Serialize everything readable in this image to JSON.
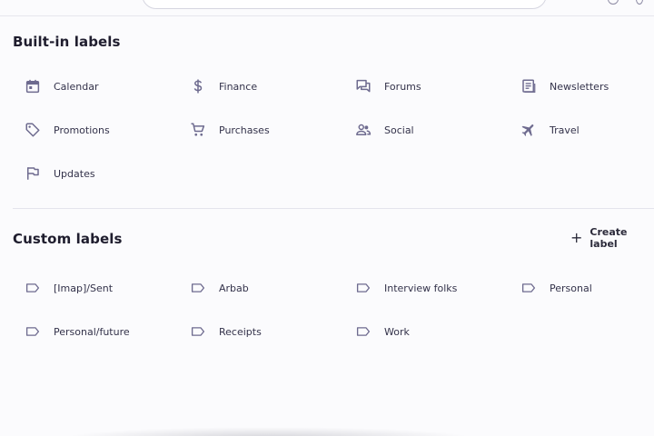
{
  "builtin": {
    "title": "Built-in labels",
    "items": [
      {
        "label": "Calendar",
        "icon": "calendar-icon"
      },
      {
        "label": "Finance",
        "icon": "dollar-icon"
      },
      {
        "label": "Forums",
        "icon": "forum-icon"
      },
      {
        "label": "Newsletters",
        "icon": "newsletter-icon"
      },
      {
        "label": "Promotions",
        "icon": "tag-icon"
      },
      {
        "label": "Purchases",
        "icon": "cart-icon"
      },
      {
        "label": "Social",
        "icon": "people-icon"
      },
      {
        "label": "Travel",
        "icon": "airplane-icon"
      },
      {
        "label": "Updates",
        "icon": "flag-icon"
      }
    ]
  },
  "custom": {
    "title": "Custom labels",
    "create_label": "Create label",
    "items": [
      {
        "label": "[Imap]/Sent",
        "icon": "label-icon"
      },
      {
        "label": "Arbab",
        "icon": "label-icon"
      },
      {
        "label": "Interview folks",
        "icon": "label-icon"
      },
      {
        "label": "Personal",
        "icon": "label-icon"
      },
      {
        "label": "Personal/future",
        "icon": "label-icon"
      },
      {
        "label": "Receipts",
        "icon": "label-icon"
      },
      {
        "label": "Work",
        "icon": "label-icon"
      }
    ]
  },
  "colors": {
    "icon": "#6e6b8f",
    "heading": "#1f1d2e",
    "text": "#33324a",
    "background": "#fbfbfd"
  }
}
